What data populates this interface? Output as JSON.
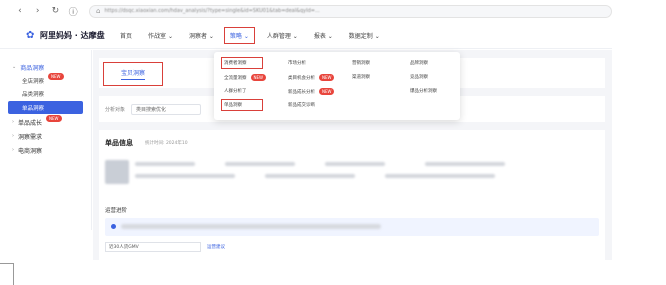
{
  "browser": {
    "url": "https://dsqc.xiaoxian.com/hdav_analysis/?type=single&id=SKU01&tab=deal&qyId=...",
    "icons": [
      "back-icon",
      "forward-icon",
      "reload-icon",
      "info-icon"
    ]
  },
  "app": {
    "logo_text": "阿里妈妈 · 达摩盘",
    "nav": [
      "首页",
      "作战室",
      "洞察者",
      "策略",
      "人群管理",
      "报表",
      "数据定制"
    ],
    "active_nav_index": 3
  },
  "sidebar": {
    "groups": [
      {
        "label": "商品洞察",
        "new": false,
        "items": [
          {
            "label": "全店洞察",
            "new": true,
            "active": false
          },
          {
            "label": "品类洞察",
            "new": false,
            "active": false
          },
          {
            "label": "单品洞察",
            "new": false,
            "active": true
          }
        ]
      },
      {
        "label": "单品成长",
        "new": true,
        "items": []
      },
      {
        "label": "洞察需求",
        "new": false,
        "items": []
      },
      {
        "label": "电商洞察",
        "new": false,
        "items": []
      }
    ]
  },
  "main": {
    "tab_active": "宝贝洞察",
    "filter_label": "分析对象",
    "filter_value": "类目搜索优化",
    "info_title": "单品信息",
    "info_time": "统计时间: 2024年10",
    "section_title": "运营进阶",
    "select_value": "近30人货GMV",
    "select_link": "运营建议"
  },
  "dropdown": {
    "items": [
      {
        "label": "消费者洞察",
        "col": 0,
        "row": 0,
        "new": false,
        "highlight": true
      },
      {
        "label": "全流量洞察",
        "col": 0,
        "row": 1,
        "new": true,
        "highlight": false
      },
      {
        "label": "人群分析了",
        "col": 0,
        "row": 2,
        "new": false,
        "highlight": false
      },
      {
        "label": "单品洞察",
        "col": 0,
        "row": 3,
        "new": false,
        "highlight": true
      },
      {
        "label": "市场分析",
        "col": 1,
        "row": 0,
        "new": false,
        "highlight": false
      },
      {
        "label": "类目机会分析",
        "col": 1,
        "row": 1,
        "new": true,
        "highlight": false
      },
      {
        "label": "新品成长分析",
        "col": 1,
        "row": 2,
        "new": true,
        "highlight": false
      },
      {
        "label": "新品成交诊断",
        "col": 1,
        "row": 3,
        "new": false,
        "highlight": false
      },
      {
        "label": "营销洞察",
        "col": 2,
        "row": 0,
        "new": false,
        "highlight": false
      },
      {
        "label": "渠道洞察",
        "col": 2,
        "row": 1,
        "new": false,
        "highlight": false
      },
      {
        "label": "品牌洞察",
        "col": 3,
        "row": 0,
        "new": false,
        "highlight": false
      },
      {
        "label": "竞品洞察",
        "col": 3,
        "row": 1,
        "new": false,
        "highlight": false
      },
      {
        "label": "爆品分析洞察",
        "col": 3,
        "row": 2,
        "new": false,
        "highlight": false
      }
    ],
    "new_label": "NEW"
  },
  "colors": {
    "accent": "#3b62e0",
    "highlight_border": "#d9403a",
    "badge": "#e8453c"
  }
}
